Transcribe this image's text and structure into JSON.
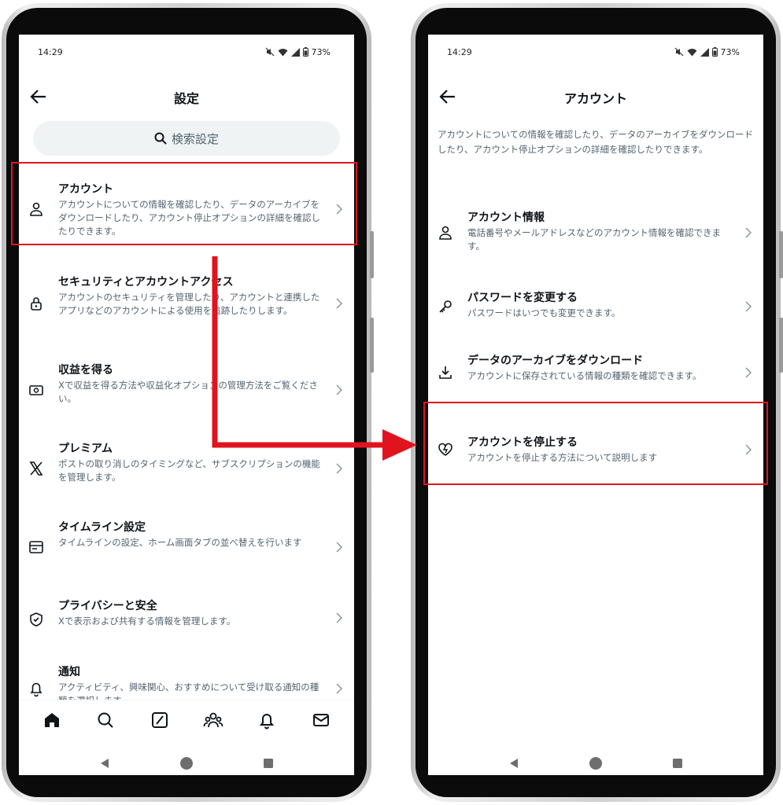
{
  "left_screen": {
    "status": {
      "time": "14:29",
      "battery": "73%"
    },
    "header": {
      "title": "設定"
    },
    "search": {
      "placeholder": "検索設定"
    },
    "items": [
      {
        "title": "アカウント",
        "desc": "アカウントについての情報を確認したり、データのアーカイブをダウンロードしたり、アカウント停止オプションの詳細を確認したりできます。",
        "icon": "person-icon"
      },
      {
        "title": "セキュリティとアカウントアクセス",
        "desc": "アカウントのセキュリティを管理したり、アカウントと連携したアプリなどのアカウントによる使用を追跡したりします。",
        "icon": "lock-icon"
      },
      {
        "title": "収益を得る",
        "desc": "Xで収益を得る方法や収益化オプションの管理方法をご覧ください。",
        "icon": "money-icon"
      },
      {
        "title": "プレミアム",
        "desc": "ポストの取り消しのタイミングなど、サブスクリプションの機能を管理します。",
        "icon": "x-logo-icon"
      },
      {
        "title": "タイムライン設定",
        "desc": "タイムラインの設定、ホーム画面タブの並べ替えを行います",
        "icon": "timeline-icon"
      },
      {
        "title": "プライバシーと安全",
        "desc": "Xで表示および共有する情報を管理します。",
        "icon": "shield-icon"
      },
      {
        "title": "通知",
        "desc": "アクティビティ、興味関心、おすすめについて受け取る通知の種類を選択します。",
        "icon": "bell-icon"
      }
    ],
    "nav_icons": [
      "home-icon",
      "search-icon",
      "grok-icon",
      "communities-icon",
      "notifications-icon",
      "messages-icon"
    ]
  },
  "right_screen": {
    "status": {
      "time": "14:29",
      "battery": "73%"
    },
    "header": {
      "title": "アカウント"
    },
    "intro": "アカウントについての情報を確認したり、データのアーカイブをダウンロードしたり、アカウント停止オプションの詳細を確認したりできます。",
    "items": [
      {
        "title": "アカウント情報",
        "desc": "電話番号やメールアドレスなどのアカウント情報を確認できます。",
        "icon": "person-icon"
      },
      {
        "title": "パスワードを変更する",
        "desc": "パスワードはいつでも変更できます。",
        "icon": "key-icon"
      },
      {
        "title": "データのアーカイブをダウンロード",
        "desc": "アカウントに保存されている情報の種類を確認できます。",
        "icon": "download-icon"
      },
      {
        "title": "アカウントを停止する",
        "desc": "アカウントを停止する方法について説明します",
        "icon": "broken-heart-icon"
      }
    ]
  },
  "annotation_color": "#e0141e"
}
